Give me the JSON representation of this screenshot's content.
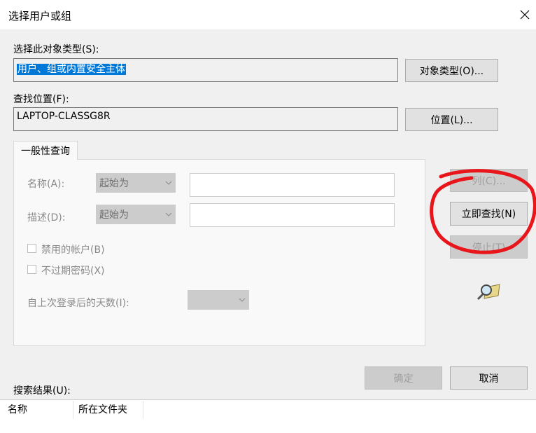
{
  "window": {
    "title": "选择用户或组"
  },
  "object_type": {
    "label": "选择此对象类型(S):",
    "value": "用户、组或内置安全主体",
    "button": "对象类型(O)..."
  },
  "location": {
    "label": "查找位置(F):",
    "value": "LAPTOP-CLASSG8R",
    "button": "位置(L)..."
  },
  "tab": {
    "label": "一般性查询"
  },
  "query": {
    "name_label": "名称(A):",
    "name_combo": "起始为",
    "desc_label": "描述(D):",
    "desc_combo": "起始为",
    "disabled_accounts": "禁用的帐户(B)",
    "no_expire_password": "不过期密码(X)",
    "days_since_login": "自上次登录后的天数(I):"
  },
  "side_buttons": {
    "columns": "列(C)...",
    "find_now": "立即查找(N)",
    "stop": "停止(T)"
  },
  "ok_button": "确定",
  "cancel_button": "取消",
  "results": {
    "label": "搜索结果(U):",
    "columns": [
      "名称",
      "所在文件夹"
    ]
  },
  "colors": {
    "selection": "#0078d7",
    "annotation_circle": "#e8151b"
  },
  "icons": {
    "close": "close-icon",
    "search": "search-icon"
  }
}
